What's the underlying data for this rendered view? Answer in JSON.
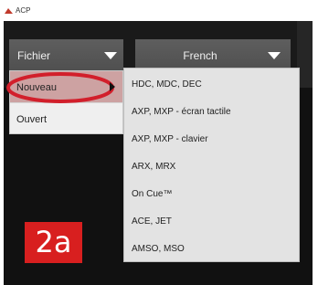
{
  "window": {
    "title": "ACP"
  },
  "toolbar": {
    "file_menu_label": "Fichier",
    "language_label": "French"
  },
  "file_menu": {
    "items": [
      {
        "label": "Nouveau",
        "highlighted": true,
        "has_submenu": true
      },
      {
        "label": "Ouvert"
      }
    ]
  },
  "submenu": {
    "items": [
      "HDC, MDC, DEC",
      "AXP, MXP - écran tactile",
      "AXP, MXP - clavier",
      "ARX, MRX",
      "On Cue™",
      "ACE, JET",
      "AMSO, MSO"
    ]
  },
  "annotation": {
    "step_label": "2a"
  },
  "colors": {
    "badge": "#d81f1f",
    "highlight_ring": "#d21f2b",
    "selected_item": "#cda2a2",
    "dropdown_bg": "#555555"
  }
}
